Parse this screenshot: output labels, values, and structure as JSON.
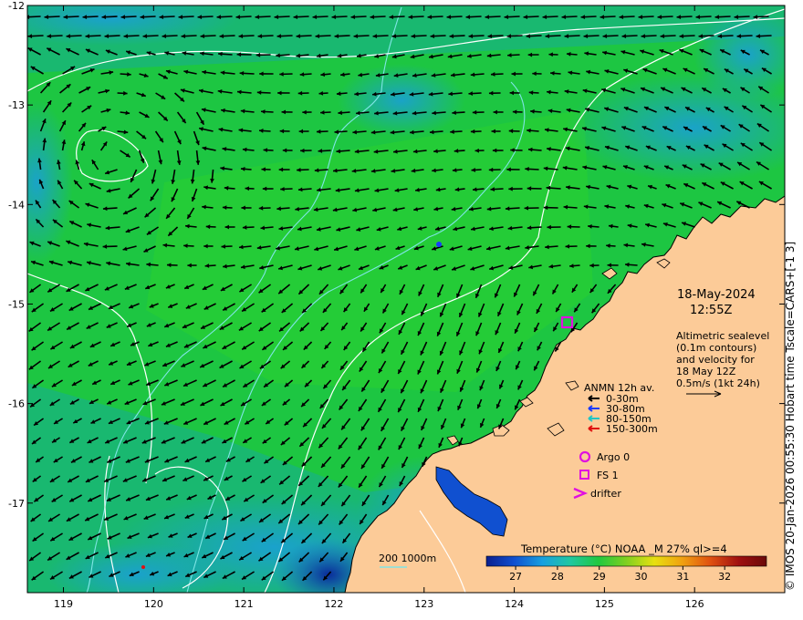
{
  "map": {
    "lon_ticks": [
      "119",
      "120",
      "121",
      "122",
      "123",
      "124",
      "125",
      "126"
    ],
    "lat_ticks": [
      "-12",
      "-13",
      "-14",
      "-15",
      "-16",
      "-17"
    ],
    "lon_range": [
      118.6,
      127.0
    ],
    "lat_range": [
      -12.0,
      -17.9
    ],
    "colors": {
      "ocean_warm": "#1fc83a",
      "ocean_mid": "#19b870",
      "ocean_cool": "#1a9fd6",
      "land": "#fccb98",
      "contour": "#ffffff",
      "isobath": "#7fe5e5",
      "marker": "#e010e0"
    }
  },
  "annotation": {
    "date": "18-May-2024",
    "time": "12:55Z",
    "altimetry": [
      "Altimetric sealevel",
      "(0.1m contours)",
      "and velocity for",
      "18 May 12Z",
      "0.5m/s (1kt 24h)"
    ]
  },
  "legend": {
    "anmn_title": "ANMN 12h av.",
    "depths": [
      {
        "label": "0-30m",
        "color": "#000000"
      },
      {
        "label": "30-80m",
        "color": "#1a3cff"
      },
      {
        "label": "80-150m",
        "color": "#22c4c4"
      },
      {
        "label": "150-300m",
        "color": "#e01010"
      }
    ],
    "argo": "Argo 0",
    "fs": "FS 1",
    "drifter": "drifter",
    "bathy": "200  1000m"
  },
  "colorbar": {
    "title": "Temperature (°C) NOAA _M 27% ql>=4",
    "ticks": [
      "27",
      "28",
      "29",
      "30",
      "31",
      "32"
    ],
    "range": [
      26.3,
      33.0
    ],
    "colors": [
      "#0a1f8f",
      "#1050d0",
      "#18a0e0",
      "#20c8a0",
      "#20c840",
      "#80d020",
      "#e8e010",
      "#f0a010",
      "#e05010",
      "#a01010",
      "#6a0a0a"
    ]
  },
  "credit": "© IMOS 20-Jan-2026 00:55:30 Hobart time Tscale=CARS+[-1 3]"
}
